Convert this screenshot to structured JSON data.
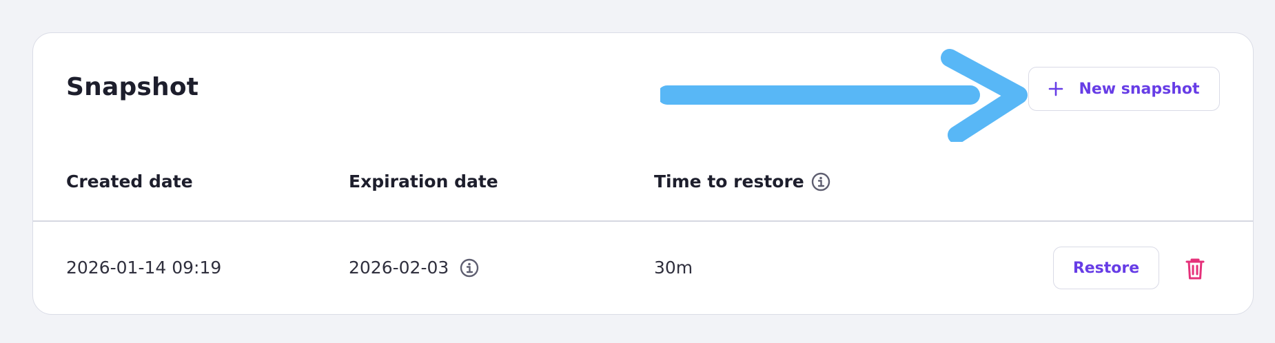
{
  "card": {
    "title": "Snapshot",
    "new_snapshot_label": "New snapshot"
  },
  "table": {
    "headers": [
      "Created date",
      "Expiration date",
      "Time to restore"
    ],
    "rows": [
      {
        "created": "2026-01-14 09:19",
        "expiration": "2026-02-03",
        "time_to_restore": "30m",
        "restore_label": "Restore"
      }
    ]
  },
  "icons": {
    "plus": "plus-icon",
    "info": "info-icon",
    "trash": "trash-icon",
    "annotation_arrow": "arrow-annotation"
  },
  "colors": {
    "accent": "#673de6",
    "danger": "#e5317a",
    "arrow": "#4fb3f6",
    "background": "#f2f3f7"
  }
}
